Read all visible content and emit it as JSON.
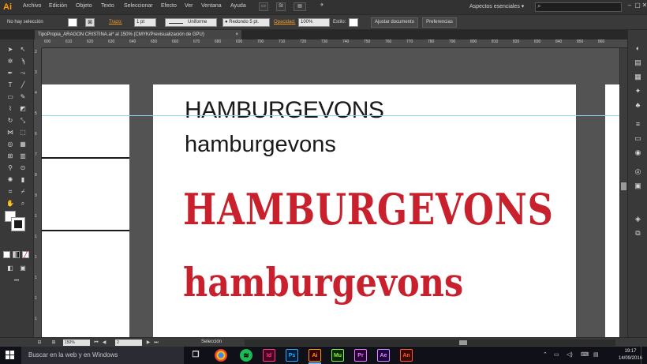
{
  "app": {
    "logo": "Ai",
    "menu": [
      "Archivo",
      "Edición",
      "Objeto",
      "Texto",
      "Seleccionar",
      "Efecto",
      "Ver",
      "Ventana",
      "Ayuda"
    ],
    "bridge_label": "Br",
    "stock_label": "St",
    "workspace": "Aspectos esenciales",
    "workspace_icon": "chevron-down-icon",
    "search_placeholder": ""
  },
  "control_bar": {
    "selection_status": "No hay selección",
    "stroke_label": "Trazo:",
    "stroke_weight": "1 pt",
    "stroke_profile": "Uniforme",
    "brush": "Redondo 5 pt.",
    "opacity_label": "Opacidad:",
    "opacity_value": "100%",
    "style_label": "Estilo:",
    "doc_setup_button": "Ajustar documento",
    "preferences_button": "Preferencias",
    "accent_color": "#f29b25"
  },
  "document": {
    "tab_title": "TipoPropia_ARAGON CRISTINA.ai* al 150% (CMYK/Previsualización de GPU)",
    "tab_close": "×"
  },
  "rulers": {
    "top_ticks": [
      "600",
      "610",
      "620",
      "630",
      "640",
      "650",
      "660",
      "670",
      "680",
      "690",
      "700",
      "710",
      "720",
      "730",
      "740",
      "750",
      "760",
      "770",
      "780",
      "790",
      "800",
      "810",
      "820",
      "830",
      "840",
      "850",
      "860"
    ],
    "left_ticks": [
      "2",
      "3",
      "4",
      "5",
      "6",
      "7",
      "8",
      "9",
      "1",
      "1",
      "1",
      "1",
      "1",
      "1"
    ]
  },
  "artboard": {
    "line1": "HAMBURGEVONS",
    "line2": "hamburgevons",
    "line3": "HAMBURGEVONS",
    "line4": "hamburgevons",
    "black_text_color": "#1a1a1a",
    "red_text_color": "#c8202c",
    "guide_color": "#8fd6ee"
  },
  "status_bar": {
    "zoom": "150%",
    "artboard_number": "2",
    "tool_status": "Selección"
  },
  "taskbar": {
    "search_text": "Buscar en la web y en Windows",
    "apps": [
      {
        "label": "Id",
        "color": "#ff3b8f",
        "bg": "#49021f"
      },
      {
        "label": "Ps",
        "color": "#31a8ff",
        "bg": "#001e36"
      },
      {
        "label": "Ai",
        "color": "#ff9a00",
        "bg": "#330000"
      },
      {
        "label": "Mu",
        "color": "#7ef05a",
        "bg": "#102800"
      },
      {
        "label": "Pr",
        "color": "#e77bff",
        "bg": "#2a0034"
      },
      {
        "label": "Ae",
        "color": "#d291ff",
        "bg": "#1f0040"
      },
      {
        "label": "An",
        "color": "#ff5a3a",
        "bg": "#3a0a00"
      }
    ],
    "time": "19:17",
    "date": "14/09/2016"
  }
}
